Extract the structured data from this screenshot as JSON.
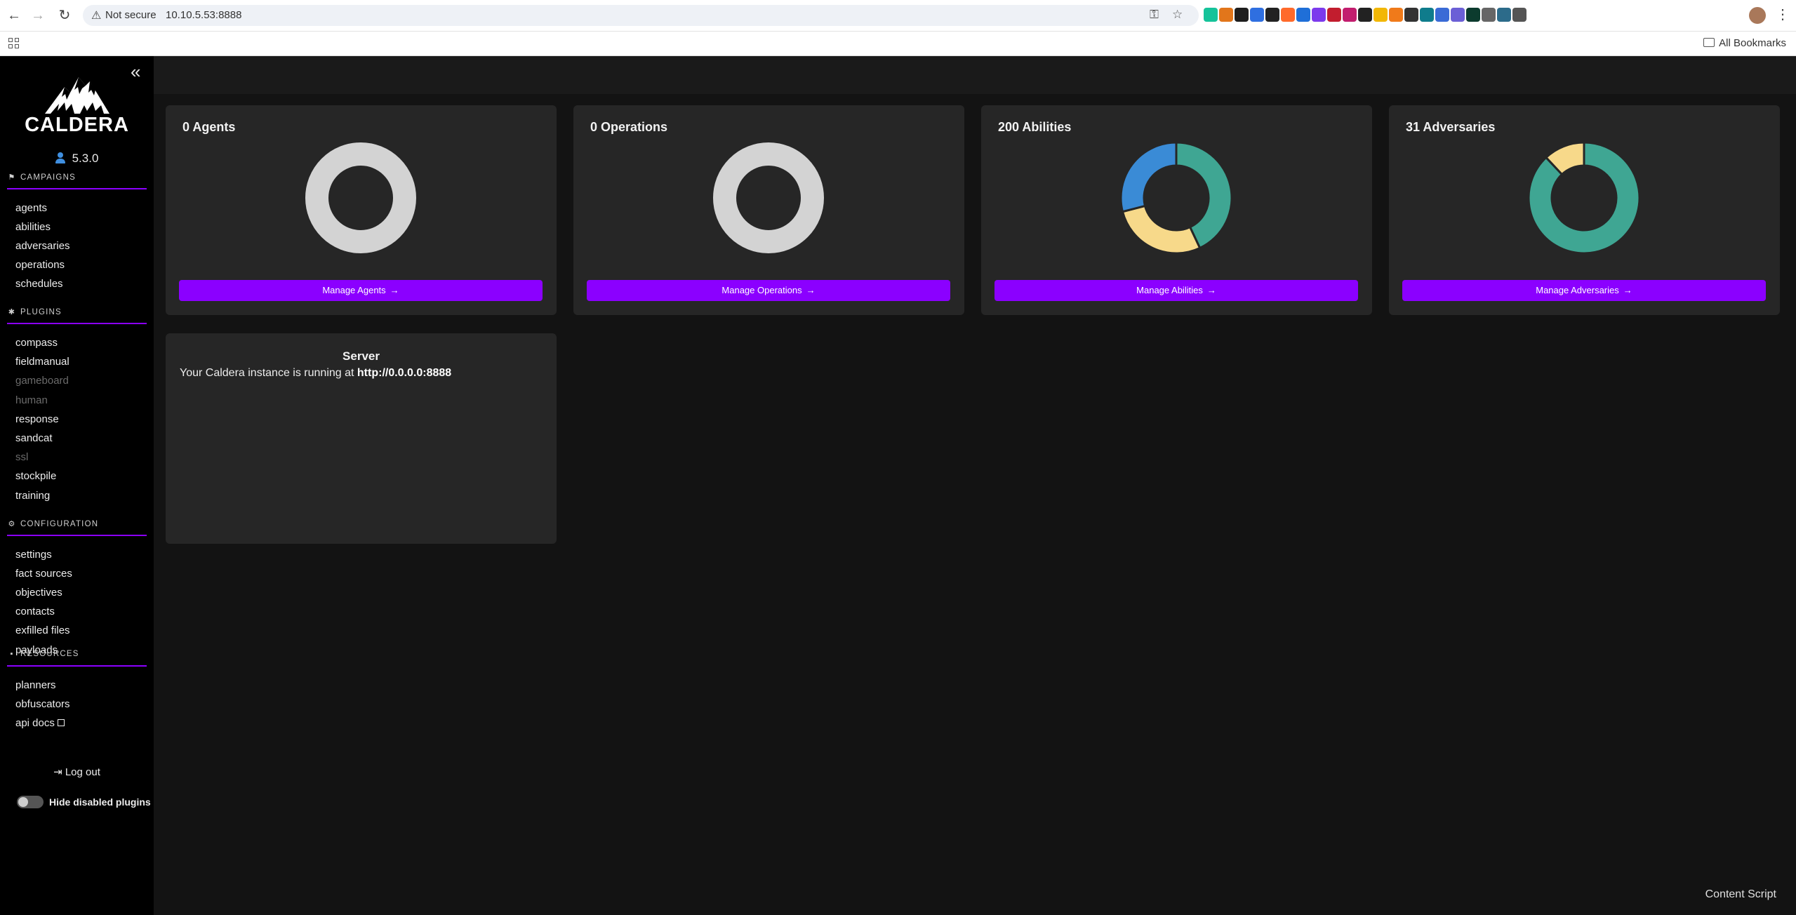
{
  "browser": {
    "security_label": "Not secure",
    "url": "10.10.5.53:8888",
    "all_bookmarks": "All Bookmarks",
    "extensions": [
      {
        "icon": "grammarly-icon",
        "color": "#15c39a"
      },
      {
        "icon": "metamask-icon",
        "color": "#e2761b"
      },
      {
        "icon": "binance-icon",
        "color": "#1e1e1e"
      },
      {
        "icon": "checker-icon",
        "color": "#2f6fe0"
      },
      {
        "icon": "puzzle-dark-icon",
        "color": "#222222"
      },
      {
        "icon": "fox-icon",
        "color": "#ff6a2b"
      },
      {
        "icon": "v-icon",
        "color": "#1f6fd8"
      },
      {
        "icon": "purple-tag-icon",
        "color": "#7c3aed"
      },
      {
        "icon": "shield-red-icon",
        "color": "#c21d2e"
      },
      {
        "icon": "u-circle-icon",
        "color": "#c21d6e"
      },
      {
        "icon": "cat-icon",
        "color": "#222222"
      },
      {
        "icon": "colorwheel-icon",
        "color": "#f2b705"
      },
      {
        "icon": "orange-square-icon",
        "color": "#f07a1a"
      },
      {
        "icon": "dots-icon",
        "color": "#333333"
      },
      {
        "icon": "teal-circle-icon",
        "color": "#0f7c8c"
      },
      {
        "icon": "blue-wing-icon",
        "color": "#3a6bd6"
      },
      {
        "icon": "purple-blob-icon",
        "color": "#6b5fd6"
      },
      {
        "icon": "terminal-icon",
        "color": "#0c3b2e"
      },
      {
        "icon": "mic-icon",
        "color": "#666666"
      },
      {
        "icon": "tile-icon",
        "color": "#2c6b8a"
      },
      {
        "icon": "puzzle-icon",
        "color": "#555555"
      }
    ]
  },
  "sidebar": {
    "logo_text": "CALDERA",
    "version": "5.3.0",
    "sections": [
      {
        "label": "CAMPAIGNS",
        "icon": "flag-icon",
        "glyph": "⚑",
        "items": [
          {
            "label": "agents",
            "disabled": false
          },
          {
            "label": "abilities",
            "disabled": false
          },
          {
            "label": "adversaries",
            "disabled": false
          },
          {
            "label": "operations",
            "disabled": false
          },
          {
            "label": "schedules",
            "disabled": false
          }
        ]
      },
      {
        "label": "PLUGINS",
        "icon": "puzzle-icon",
        "glyph": "✱",
        "items": [
          {
            "label": "compass",
            "disabled": false
          },
          {
            "label": "fieldmanual",
            "disabled": false
          },
          {
            "label": "gameboard",
            "disabled": true
          },
          {
            "label": "human",
            "disabled": true
          },
          {
            "label": "response",
            "disabled": false
          },
          {
            "label": "sandcat",
            "disabled": false
          },
          {
            "label": "ssl",
            "disabled": true
          },
          {
            "label": "stockpile",
            "disabled": false
          },
          {
            "label": "training",
            "disabled": false
          }
        ]
      },
      {
        "label": "CONFIGURATION",
        "icon": "gear-icon",
        "glyph": "⚙",
        "items": [
          {
            "label": "settings",
            "disabled": false
          },
          {
            "label": "fact sources",
            "disabled": false
          },
          {
            "label": "objectives",
            "disabled": false
          },
          {
            "label": "contacts",
            "disabled": false
          },
          {
            "label": "exfilled files",
            "disabled": false
          },
          {
            "label": "payloads",
            "disabled": false
          }
        ]
      },
      {
        "label": "RESOURCES",
        "icon": "book-icon",
        "glyph": "▪",
        "items": [
          {
            "label": "planners",
            "disabled": false
          },
          {
            "label": "obfuscators",
            "disabled": false
          },
          {
            "label": "api docs",
            "disabled": false,
            "external": true
          }
        ]
      }
    ],
    "logout_label": "Log out",
    "hide_disabled_label": "Hide disabled plugins",
    "hide_disabled_on": false
  },
  "cards": [
    {
      "title": "0 Agents",
      "button": "Manage Agents",
      "segments": [
        {
          "value": 1,
          "color": "#d3d3d3"
        }
      ]
    },
    {
      "title": "0 Operations",
      "button": "Manage Operations",
      "segments": [
        {
          "value": 1,
          "color": "#d3d3d3"
        }
      ]
    },
    {
      "title": "200 Abilities",
      "button": "Manage Abilities",
      "segments": [
        {
          "value": 0.43,
          "color": "#3fa693"
        },
        {
          "value": 0.28,
          "color": "#f7d98a"
        },
        {
          "value": 0.29,
          "color": "#3a8bd6"
        }
      ]
    },
    {
      "title": "31 Adversaries",
      "button": "Manage Adversaries",
      "segments": [
        {
          "value": 0.88,
          "color": "#3fa693"
        },
        {
          "value": 0.12,
          "color": "#f7d98a"
        }
      ]
    }
  ],
  "server": {
    "title": "Server",
    "message": "Your Caldera instance is running at ",
    "address": "http://0.0.0.0:8888"
  },
  "footer": {
    "content_script": "Content Script"
  },
  "colors": {
    "accent": "#8b00ff",
    "sidebar_bg": "#000000",
    "card_bg": "#262626",
    "page_bg": "#131313"
  }
}
